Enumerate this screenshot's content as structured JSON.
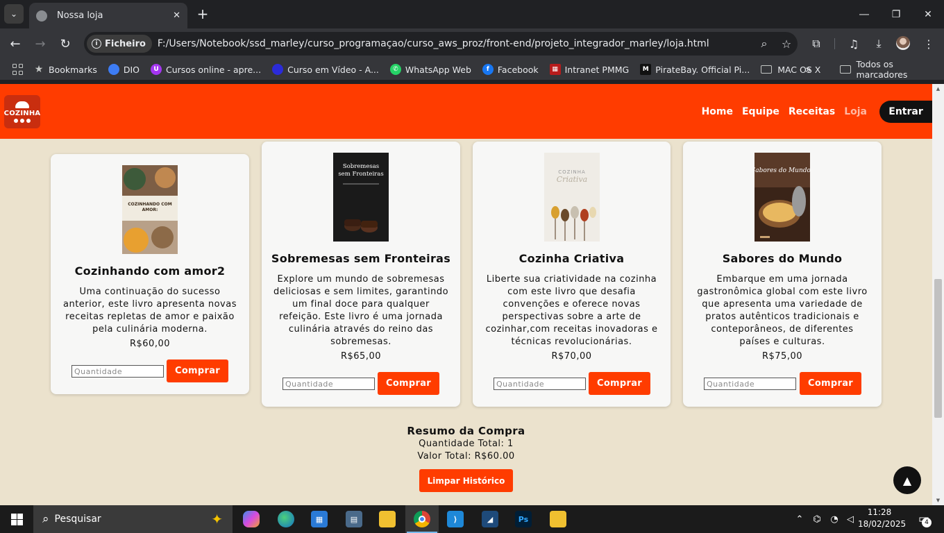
{
  "browser": {
    "tab_title": "Nossa loja",
    "tab_close": "✕",
    "new_tab": "+",
    "omnibox_chip": "Ficheiro",
    "url": "F:/Users/Notebook/ssd_marley/curso_programaçao/curso_aws_proz/front-end/projeto_integrador_marley/loja.html",
    "bookmarks": [
      {
        "label": "Bookmarks",
        "icon": "star-icon",
        "color": "#c4c7c5"
      },
      {
        "label": "DIO",
        "icon": "dio-icon",
        "color": "#3d7cf4"
      },
      {
        "label": "Cursos online - apre...",
        "icon": "udemy-icon",
        "color": "#a435f0"
      },
      {
        "label": "Curso em Vídeo - A...",
        "icon": "cursoemvideo-icon",
        "color": "#2b2bd8"
      },
      {
        "label": "WhatsApp Web",
        "icon": "whatsapp-icon",
        "color": "#25d366"
      },
      {
        "label": "Facebook",
        "icon": "facebook-icon",
        "color": "#1877f2"
      },
      {
        "label": "Intranet PMMG",
        "icon": "intranet-icon",
        "color": "#b71c1c"
      },
      {
        "label": "PirateBay. Official Pi...",
        "icon": "piratebay-icon",
        "color": "#111111"
      },
      {
        "label": "MAC OS X",
        "icon": "folder-icon",
        "color": "#c4c7c5"
      }
    ],
    "bookmarks_overflow": "»",
    "all_bookmarks": "Todos os marcadores"
  },
  "site": {
    "logo_text": "COZINHA",
    "nav": [
      "Home",
      "Equipe",
      "Receitas",
      "Loja"
    ],
    "active_nav": "Loja",
    "login_label": "Entrar",
    "accent_color": "#ff3c00"
  },
  "products": [
    {
      "title": "Cozinhando com amor2",
      "description": "Uma continuação do sucesso anterior, este livro apresenta novas receitas repletas de amor e paixão pela culinária moderna.",
      "price": "R$60,00",
      "quantity_placeholder": "Quantidade",
      "buy_label": "Comprar",
      "cover_text": "COZINHANDO COM AMOR"
    },
    {
      "title": "Sobremesas sem Fronteiras",
      "description": "Explore um mundo de sobremesas deliciosas e sem limites, garantindo um final doce para qualquer refeição. Este livro é uma jornada culinária através do reino das sobremesas.",
      "price": "R$65,00",
      "quantity_placeholder": "Quantidade",
      "buy_label": "Comprar",
      "cover_text": "Sobremesas sem Fronteiras"
    },
    {
      "title": "Cozinha Criativa",
      "description": "Liberte sua criatividade na cozinha com este livro que desafia convenções e oferece novas perspectivas sobre a arte de cozinhar,com receitas inovadoras e técnicas revolucionárias.",
      "price": "R$70,00",
      "quantity_placeholder": "Quantidade",
      "buy_label": "Comprar",
      "cover_text": "Criativa"
    },
    {
      "title": "Sabores do Mundo",
      "description": "Embarque em uma jornada gastronômica global com este livro que apresenta uma variedade de pratos autênticos tradicionais e conteporâneos, de diferentes países e culturas.",
      "price": "R$75,00",
      "quantity_placeholder": "Quantidade",
      "buy_label": "Comprar",
      "cover_text": "Sabores do Mundo"
    }
  ],
  "summary": {
    "title": "Resumo da Compra",
    "total_quantity": "Quantidade Total: 1",
    "total_value": "Valor Total: R$60.00",
    "clear_label": "Limpar Histórico",
    "back_to_top": "▲"
  },
  "taskbar": {
    "search_placeholder": "Pesquisar",
    "apps": [
      "copilot-icon",
      "edge-icon",
      "store-icon",
      "calculator-icon",
      "file-explorer-icon",
      "chrome-icon",
      "vscode-icon",
      "mysql-workbench-icon",
      "photoshop-icon",
      "folder-icon"
    ],
    "time": "11:28",
    "date": "18/02/2025",
    "notifications_count": "4"
  }
}
